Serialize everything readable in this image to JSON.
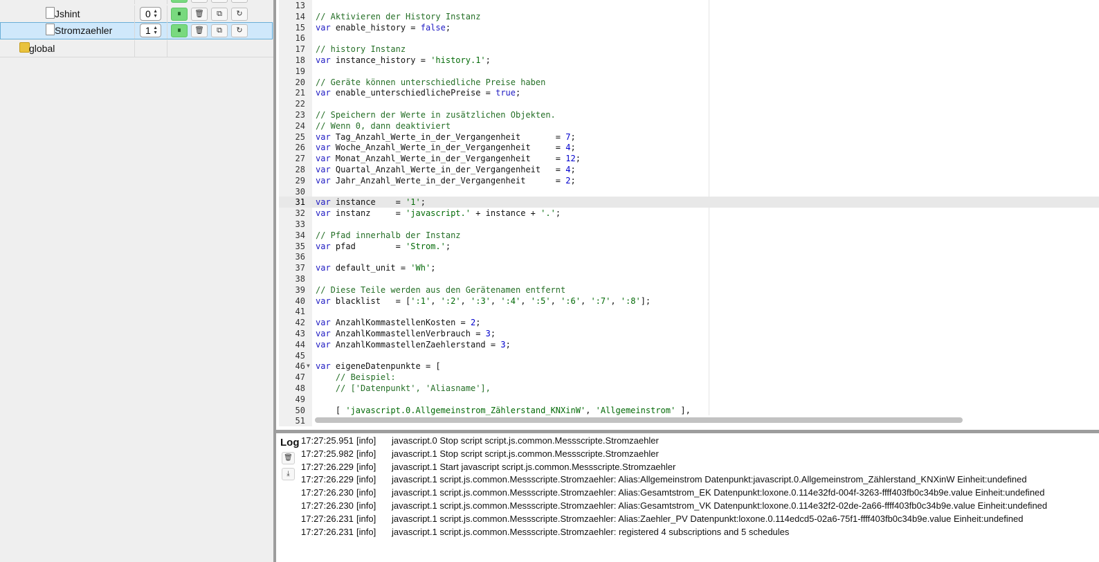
{
  "tree": {
    "rows": [
      {
        "name": "Jshint",
        "instance": "0",
        "selected": false
      },
      {
        "name": "Stromzaehler",
        "instance": "1",
        "selected": true
      }
    ],
    "folder": {
      "name": "global"
    },
    "buttons": {
      "pause": "⏸",
      "delete": "🗑",
      "copy": "⧉",
      "restart": "↻"
    }
  },
  "editor": {
    "active_line": 31,
    "lines": [
      {
        "n": "13",
        "code": ""
      },
      {
        "n": "14",
        "code": "<span class='cmt'>// Aktivieren der History Instanz</span>"
      },
      {
        "n": "15",
        "code": "<span class='kw'>var</span> enable_history = <span class='kw'>false</span>;"
      },
      {
        "n": "16",
        "code": ""
      },
      {
        "n": "17",
        "code": "<span class='cmt'>// history Instanz</span>"
      },
      {
        "n": "18",
        "code": "<span class='kw'>var</span> instance_history = <span class='str'>'history.1'</span>;"
      },
      {
        "n": "19",
        "code": ""
      },
      {
        "n": "20",
        "code": "<span class='cmt'>// Geräte können unterschiedliche Preise haben</span>"
      },
      {
        "n": "21",
        "code": "<span class='kw'>var</span> enable_unterschiedlichePreise = <span class='kw'>true</span>;"
      },
      {
        "n": "22",
        "code": ""
      },
      {
        "n": "23",
        "code": "<span class='cmt'>// Speichern der Werte in zusätzlichen Objekten.</span>"
      },
      {
        "n": "24",
        "code": "<span class='cmt'>// Wenn 0, dann deaktiviert</span>"
      },
      {
        "n": "25",
        "code": "<span class='kw'>var</span> Tag_Anzahl_Werte_in_der_Vergangenheit       = <span class='num'>7</span>;"
      },
      {
        "n": "26",
        "code": "<span class='kw'>var</span> Woche_Anzahl_Werte_in_der_Vergangenheit     = <span class='num'>4</span>;"
      },
      {
        "n": "27",
        "code": "<span class='kw'>var</span> Monat_Anzahl_Werte_in_der_Vergangenheit     = <span class='num'>12</span>;"
      },
      {
        "n": "28",
        "code": "<span class='kw'>var</span> Quartal_Anzahl_Werte_in_der_Vergangenheit   = <span class='num'>4</span>;"
      },
      {
        "n": "29",
        "code": "<span class='kw'>var</span> Jahr_Anzahl_Werte_in_der_Vergangenheit      = <span class='num'>2</span>;"
      },
      {
        "n": "30",
        "code": ""
      },
      {
        "n": "31",
        "code": "<span class='kw'>var</span> instance    = <span class='str'>'1'</span>;"
      },
      {
        "n": "32",
        "code": "<span class='kw'>var</span> instanz     = <span class='str'>'javascript.'</span> + instance + <span class='str'>'.'</span>;"
      },
      {
        "n": "33",
        "code": ""
      },
      {
        "n": "34",
        "code": "<span class='cmt'>// Pfad innerhalb der Instanz</span>"
      },
      {
        "n": "35",
        "code": "<span class='kw'>var</span> pfad        = <span class='str'>'Strom.'</span>;"
      },
      {
        "n": "36",
        "code": ""
      },
      {
        "n": "37",
        "code": "<span class='kw'>var</span> default_unit = <span class='str'>'Wh'</span>;"
      },
      {
        "n": "38",
        "code": ""
      },
      {
        "n": "39",
        "code": "<span class='cmt'>// Diese Teile werden aus den Gerätenamen entfernt</span>"
      },
      {
        "n": "40",
        "code": "<span class='kw'>var</span> blacklist   = [<span class='str'>':1'</span>, <span class='str'>':2'</span>, <span class='str'>':3'</span>, <span class='str'>':4'</span>, <span class='str'>':5'</span>, <span class='str'>':6'</span>, <span class='str'>':7'</span>, <span class='str'>':8'</span>];"
      },
      {
        "n": "41",
        "code": ""
      },
      {
        "n": "42",
        "code": "<span class='kw'>var</span> AnzahlKommastellenKosten = <span class='num'>2</span>;"
      },
      {
        "n": "43",
        "code": "<span class='kw'>var</span> AnzahlKommastellenVerbrauch = <span class='num'>3</span>;"
      },
      {
        "n": "44",
        "code": "<span class='kw'>var</span> AnzahlKommastellenZaehlerstand = <span class='num'>3</span>;"
      },
      {
        "n": "45",
        "code": ""
      },
      {
        "n": "46",
        "code": "<span class='kw'>var</span> eigeneDatenpunkte = [",
        "fold": true
      },
      {
        "n": "47",
        "code": "    <span class='cmt'>// Beispiel:</span>"
      },
      {
        "n": "48",
        "code": "    <span class='cmt'>// ['Datenpunkt', 'Aliasname'],</span>"
      },
      {
        "n": "49",
        "code": ""
      },
      {
        "n": "50",
        "code": "    [ <span class='str'>'javascript.0.Allgemeinstrom_Zählerstand_KNXinW'</span>, <span class='str'>'Allgemeinstrom'</span> ],"
      },
      {
        "n": "51",
        "code": ""
      }
    ]
  },
  "log": {
    "title": "Log",
    "clear_icon": "🗑",
    "download_icon": "⤓",
    "entries": [
      {
        "time": "17:27:25.951",
        "level": "[info]",
        "message": "javascript.0 Stop script script.js.common.Messscripte.Stromzaehler"
      },
      {
        "time": "17:27:25.982",
        "level": "[info]",
        "message": "javascript.1 Stop script script.js.common.Messscripte.Stromzaehler"
      },
      {
        "time": "17:27:26.229",
        "level": "[info]",
        "message": "javascript.1 Start javascript script.js.common.Messscripte.Stromzaehler"
      },
      {
        "time": "17:27:26.229",
        "level": "[info]",
        "message": "javascript.1 script.js.common.Messscripte.Stromzaehler: Alias:Allgemeinstrom Datenpunkt:javascript.0.Allgemeinstrom_Zählerstand_KNXinW Einheit:undefined"
      },
      {
        "time": "17:27:26.230",
        "level": "[info]",
        "message": "javascript.1 script.js.common.Messscripte.Stromzaehler: Alias:Gesamtstrom_EK Datenpunkt:loxone.0.114e32fd-004f-3263-ffff403fb0c34b9e.value Einheit:undefined"
      },
      {
        "time": "17:27:26.230",
        "level": "[info]",
        "message": "javascript.1 script.js.common.Messscripte.Stromzaehler: Alias:Gesamtstrom_VK Datenpunkt:loxone.0.114e32f2-02de-2a66-ffff403fb0c34b9e.value Einheit:undefined"
      },
      {
        "time": "17:27:26.231",
        "level": "[info]",
        "message": "javascript.1 script.js.common.Messscripte.Stromzaehler: Alias:Zaehler_PV Datenpunkt:loxone.0.114edcd5-02a6-75f1-ffff403fb0c34b9e.value Einheit:undefined"
      },
      {
        "time": "17:27:26.231",
        "level": "[info]",
        "message": "javascript.1 script.js.common.Messscripte.Stromzaehler: registered 4 subscriptions and 5 schedules"
      }
    ]
  }
}
